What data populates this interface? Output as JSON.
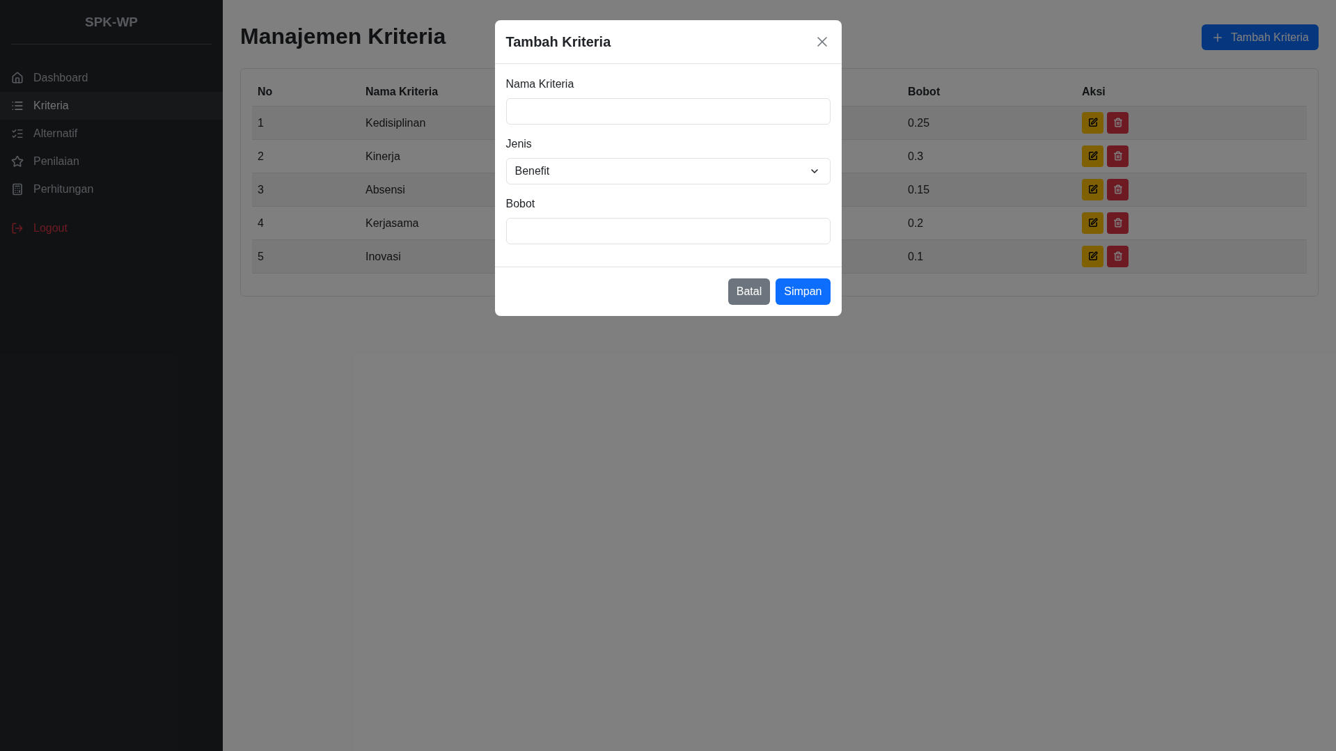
{
  "sidebar": {
    "brand": "SPK-WP",
    "items": [
      {
        "label": "Dashboard",
        "selected": false,
        "kind": "nav"
      },
      {
        "label": "Kriteria",
        "selected": true,
        "kind": "nav"
      },
      {
        "label": "Alternatif",
        "selected": false,
        "kind": "nav"
      },
      {
        "label": "Penilaian",
        "selected": false,
        "kind": "nav"
      },
      {
        "label": "Perhitungan",
        "selected": false,
        "kind": "nav"
      },
      {
        "label": "Logout",
        "selected": false,
        "kind": "logout"
      }
    ]
  },
  "page": {
    "title": "Manajemen Kriteria",
    "add_button": "Tambah Kriteria"
  },
  "table": {
    "columns": [
      "No",
      "Nama Kriteria",
      "Bobot",
      "Aksi"
    ],
    "rows": [
      {
        "no": "1",
        "name": "Kedisiplinan",
        "weight": "0.25"
      },
      {
        "no": "2",
        "name": "Kinerja",
        "weight": "0.3"
      },
      {
        "no": "3",
        "name": "Absensi",
        "weight": "0.15"
      },
      {
        "no": "4",
        "name": "Kerjasama",
        "weight": "0.2"
      },
      {
        "no": "5",
        "name": "Inovasi",
        "weight": "0.1"
      }
    ]
  },
  "modal": {
    "title": "Tambah Kriteria",
    "fields": [
      {
        "label": "Nama Kriteria",
        "kind": "text"
      },
      {
        "label": "Jenis",
        "kind": "select",
        "value": "Benefit"
      },
      {
        "label": "Bobot",
        "kind": "text"
      }
    ],
    "buttons": [
      {
        "label": "Batal",
        "kind": "secondary"
      },
      {
        "label": "Simpan",
        "kind": "primary"
      }
    ]
  }
}
